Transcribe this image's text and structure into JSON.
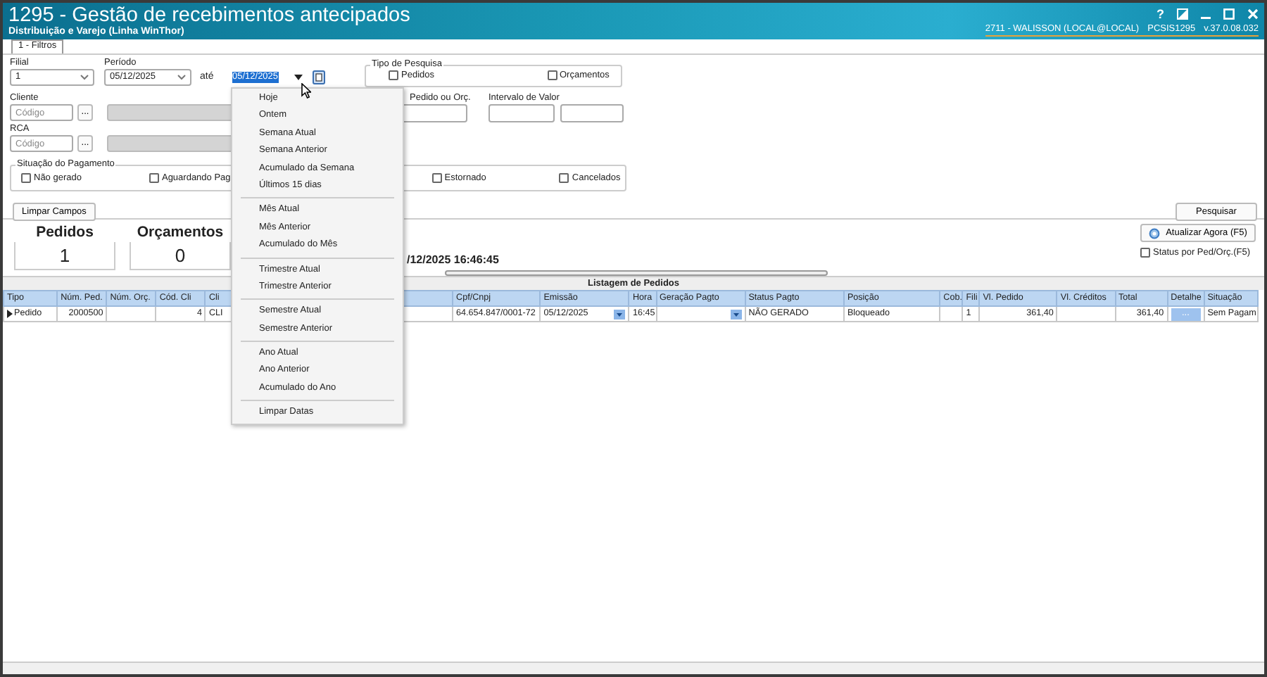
{
  "window": {
    "title": "1295 - Gestão de recebimentos antecipados",
    "subtitle": "Distribuição e Varejo (Linha WinThor)",
    "help": "?",
    "user_info": "2711 - WALISSON (LOCAL@LOCAL)",
    "program": "PCSIS1295",
    "version": "v.37.0.08.032"
  },
  "tabs": [
    {
      "label": "1 - Filtros",
      "selected": true
    }
  ],
  "filters": {
    "filial": {
      "label": "Filial",
      "value": "1"
    },
    "periodo": {
      "label": "Período",
      "start": "05/12/2025",
      "between": "até",
      "end": "05/12/2025"
    },
    "tipo_pesquisa": {
      "label": "Tipo de Pesquisa",
      "options": [
        {
          "label": "Pedidos",
          "checked": false
        },
        {
          "label": "Orçamentos",
          "checked": false
        }
      ]
    },
    "cliente": {
      "label": "Cliente",
      "placeholder": "Código",
      "browse": "..."
    },
    "rca": {
      "label": "RCA",
      "placeholder": "Código",
      "browse": "..."
    },
    "pedido_orc": {
      "label": "Pedido ou Orç."
    },
    "intervalo_valor": {
      "label": "Intervalo de Valor"
    },
    "situacao_pagamento": {
      "label": "Situação do Pagamento",
      "options": [
        {
          "label": "Não gerado",
          "checked": false
        },
        {
          "label": "Aguardando Pag",
          "checked": false
        },
        {
          "label": "Estornado",
          "checked": false
        },
        {
          "label": "Cancelados",
          "checked": false
        }
      ]
    },
    "clear_button": "Limpar Campos",
    "search_button": "Pesquisar"
  },
  "summary": {
    "counters": [
      {
        "label": "Pedidos",
        "value": "1"
      },
      {
        "label": "Orçamentos",
        "value": "0"
      }
    ],
    "timestamp": "/12/2025 16:46:45",
    "refresh_button": "Atualizar Agora (F5)",
    "status_toggle": {
      "label": "Status por Ped/Orç.(F5)",
      "checked": false
    }
  },
  "grid": {
    "title": "Listagem de Pedidos",
    "columns": [
      {
        "label": "Tipo",
        "kind": "text"
      },
      {
        "label": "Núm. Ped.",
        "kind": "number"
      },
      {
        "label": "Núm. Orç.",
        "kind": "number"
      },
      {
        "label": "Cód. Cli",
        "kind": "number"
      },
      {
        "label": "Cli",
        "kind": "wide"
      },
      {
        "label": "Cpf/Cnpj",
        "kind": "text"
      },
      {
        "label": "Emissão",
        "kind": "combo"
      },
      {
        "label": "Hora",
        "kind": "text"
      },
      {
        "label": "Geração Pagto",
        "kind": "combo"
      },
      {
        "label": "Status Pagto",
        "kind": "text"
      },
      {
        "label": "Posição",
        "kind": "text"
      },
      {
        "label": "Cob.",
        "kind": "text"
      },
      {
        "label": "Fili",
        "kind": "text"
      },
      {
        "label": "Vl. Pedido",
        "kind": "number"
      },
      {
        "label": "Vl. Créditos",
        "kind": "number"
      },
      {
        "label": "Total",
        "kind": "number"
      },
      {
        "label": "Detalhe",
        "kind": "button"
      },
      {
        "label": "Situação",
        "kind": "text"
      }
    ],
    "rows": [
      {
        "selected": true,
        "cells": [
          "Pedido",
          "2000500",
          null,
          "4",
          "CLI",
          "64.654.847/0001-72",
          "05/12/2025",
          "16:45",
          null,
          "NÃO GERADO",
          "Bloqueado",
          null,
          "1",
          "361,40",
          null,
          "361,40",
          "...",
          "Sem Pagam"
        ]
      }
    ]
  },
  "date_menu": {
    "groups": [
      [
        "Hoje",
        "Ontem",
        "Semana Atual",
        "Semana Anterior",
        "Acumulado da Semana",
        "Últimos 15 dias"
      ],
      [
        "Mês Atual",
        "Mês Anterior",
        "Acumulado do Mês"
      ],
      [
        "Trimestre Atual",
        "Trimestre Anterior"
      ],
      [
        "Semestre Atual",
        "Semestre Anterior"
      ],
      [
        "Ano Atual",
        "Ano Anterior",
        "Acumulado do Ano"
      ],
      [
        "Limpar Datas"
      ]
    ]
  }
}
